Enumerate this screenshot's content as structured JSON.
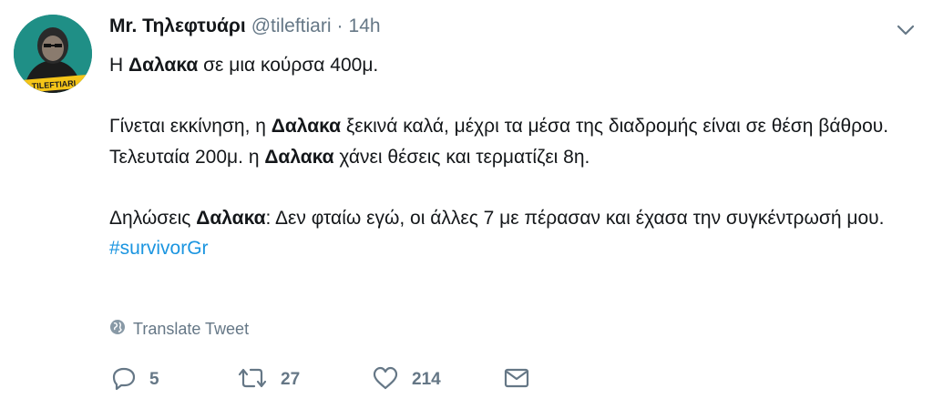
{
  "user": {
    "display_name": "Mr. Τηλεφτυάρι",
    "handle": "@tileftiari",
    "separator": "·",
    "time": "14h",
    "avatar_text": "TILEFTIARI"
  },
  "tweet": {
    "line1": {
      "t1": "Η ",
      "b1": "Δαλακα",
      "t2": " σε μια κούρσα 400μ."
    },
    "line2": {
      "t1": "Γίνεται εκκίνηση, η ",
      "b1": "Δαλακα",
      "t2": " ξεκινά καλά, μέχρι τα μέσα της διαδρομής είναι σε θέση βάθρου."
    },
    "line3": {
      "t1": "Τελευταία 200μ. η ",
      "b1": "Δαλακα",
      "t2": " χάνει θέσεις και τερματίζει 8η."
    },
    "line4": {
      "t1": "Δηλώσεις ",
      "b1": "Δαλακα",
      "t2": ": Δεν φταίω εγώ, οι άλλες 7 με πέρασαν και έχασα την συγκέντρωσή μου. ",
      "hashtag": "#survivorGr"
    }
  },
  "translate": {
    "label": "Translate Tweet",
    "icon": "globe-icon"
  },
  "actions": {
    "reply": {
      "count": "5",
      "icon": "reply-icon"
    },
    "retweet": {
      "count": "27",
      "icon": "retweet-icon"
    },
    "like": {
      "count": "214",
      "icon": "heart-icon"
    },
    "message": {
      "icon": "envelope-icon"
    }
  },
  "colors": {
    "text": "#14171a",
    "secondary": "#657786",
    "link": "#1b95e0",
    "avatar_bg": "#1f8f86",
    "avatar_badge": "#f5c518"
  }
}
